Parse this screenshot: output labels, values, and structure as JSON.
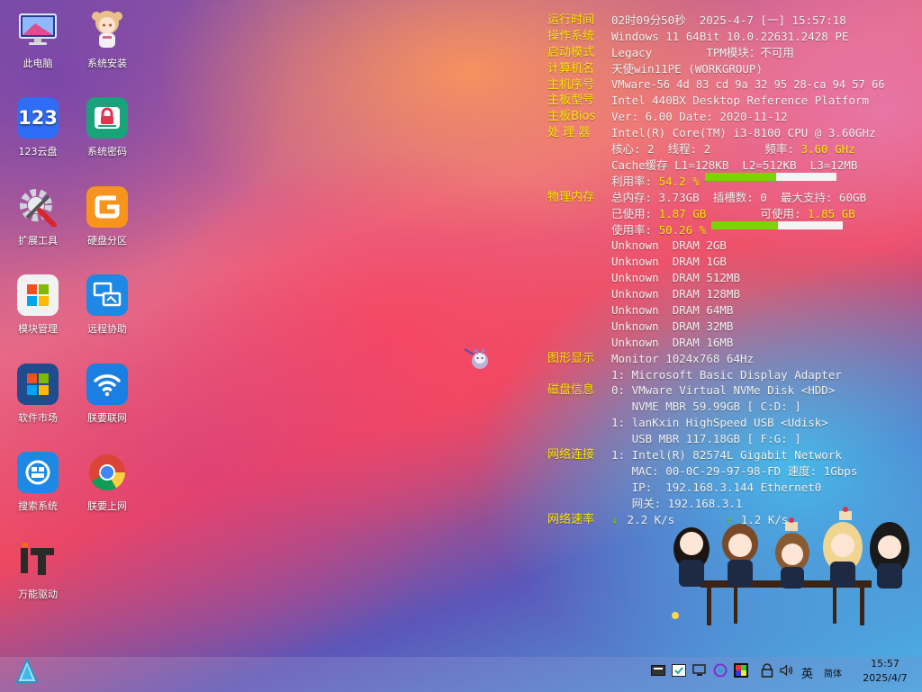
{
  "desktop_icons": [
    {
      "label": "此电脑",
      "icon": "monitor-icon"
    },
    {
      "label": "系统安装",
      "icon": "anime-girl-icon"
    },
    {
      "label": "123云盘",
      "icon": "123-cloud-icon"
    },
    {
      "label": "系统密码",
      "icon": "lock-icon"
    },
    {
      "label": "扩展工具",
      "icon": "tools-gear-icon"
    },
    {
      "label": "硬盘分区",
      "icon": "partition-icon"
    },
    {
      "label": "模块管理",
      "icon": "module-icon"
    },
    {
      "label": "远程协助",
      "icon": "remote-icon"
    },
    {
      "label": "软件市场",
      "icon": "store-icon"
    },
    {
      "label": "朕要联网",
      "icon": "wifi-icon"
    },
    {
      "label": "搜索系统",
      "icon": "search-system-icon"
    },
    {
      "label": "朕要上网",
      "icon": "chrome-icon"
    },
    {
      "label": "万能驱动",
      "icon": "it-driver-icon"
    }
  ],
  "sysinfo": {
    "runtime_label": "运行时间",
    "runtime": "02时09分50秒  2025-4-7 [一] 15:57:18",
    "os_label": "操作系统",
    "os": "Windows 11 64Bit 10.0.22631.2428 PE",
    "boot_label": "启动模式",
    "boot": "Legacy        TPM模块：不可用",
    "pc_label": "计算机名",
    "pc": "天使win11PE (WORKGROUP)",
    "serial_label": "主机序号",
    "serial": "VMware-56 4d 83 cd 9a 32 95 28-ca 94 57 66",
    "board_label": "主板型号",
    "board": "Intel 440BX Desktop Reference Platform",
    "bios_label": "主板Bios",
    "bios": "Ver: 6.00 Date: 2020-11-12",
    "cpu_label": "处 理 器",
    "cpu": "Intel(R) Core(TM) i3-8100 CPU @ 3.60GHz",
    "cpu_cores": "核心: 2  线程: 2        频率: ",
    "cpu_freq": "3.60 GHz",
    "cpu_cache": "Cache缓存 L1=128KB  L2=512KB  L3=12MB",
    "cpu_usage_label": "利用率: ",
    "cpu_usage": "54.2 %",
    "cpu_usage_fraction": 0.542,
    "mem_label": "物理内存",
    "mem_total": "总内存: 3.73GB  插槽数: 0  最大支持: 60GB",
    "mem_used_label": "已使用: ",
    "mem_used": "1.87 GB",
    "mem_avail_label": "        可使用: ",
    "mem_avail": "1.85 GB",
    "mem_usage_label": "使用率: ",
    "mem_usage": "50.26 %",
    "mem_usage_fraction": 0.5026,
    "dram": [
      "Unknown  DRAM 2GB",
      "Unknown  DRAM 1GB",
      "Unknown  DRAM 512MB",
      "Unknown  DRAM 128MB",
      "Unknown  DRAM 64MB",
      "Unknown  DRAM 32MB",
      "Unknown  DRAM 16MB"
    ],
    "gpu_label": "图形显示",
    "gpu_monitor": "Monitor 1024x768 64Hz",
    "gpu_adapter": "1: Microsoft Basic Display Adapter",
    "disk_label": "磁盘信息",
    "disk0": "0: VMware Virtual NVMe Disk <HDD>",
    "disk0_detail": "   NVME MBR 59.99GB [ C:D: ]",
    "disk1": "1: lanKxin HighSpeed USB <Udisk>",
    "disk1_detail": "   USB MBR 117.18GB [ F:G: ]",
    "net_label": "网络连接",
    "net_adapter": "1: Intel(R) 82574L Gigabit Network",
    "net_mac": "   MAC: 00-0C-29-97-98-FD 速度: 1Gbps",
    "net_ip": "   IP:  192.168.3.144 Ethernet0",
    "net_gw": "   网关: 192.168.3.1",
    "speed_label": "网络速率",
    "speed_down_arrow": "↓",
    "speed_down": "2.2 K/s",
    "speed_up_arrow": "↑",
    "speed_up": "1.2 K/s"
  },
  "taskbar": {
    "ime_lang": "英",
    "ime_mode": "简体",
    "time": "15:57",
    "date": "2025/4/7"
  },
  "colors": {
    "label": "#ffe600",
    "bar_fill": "#7ad400",
    "bar_bg": "#f4f4f4"
  }
}
